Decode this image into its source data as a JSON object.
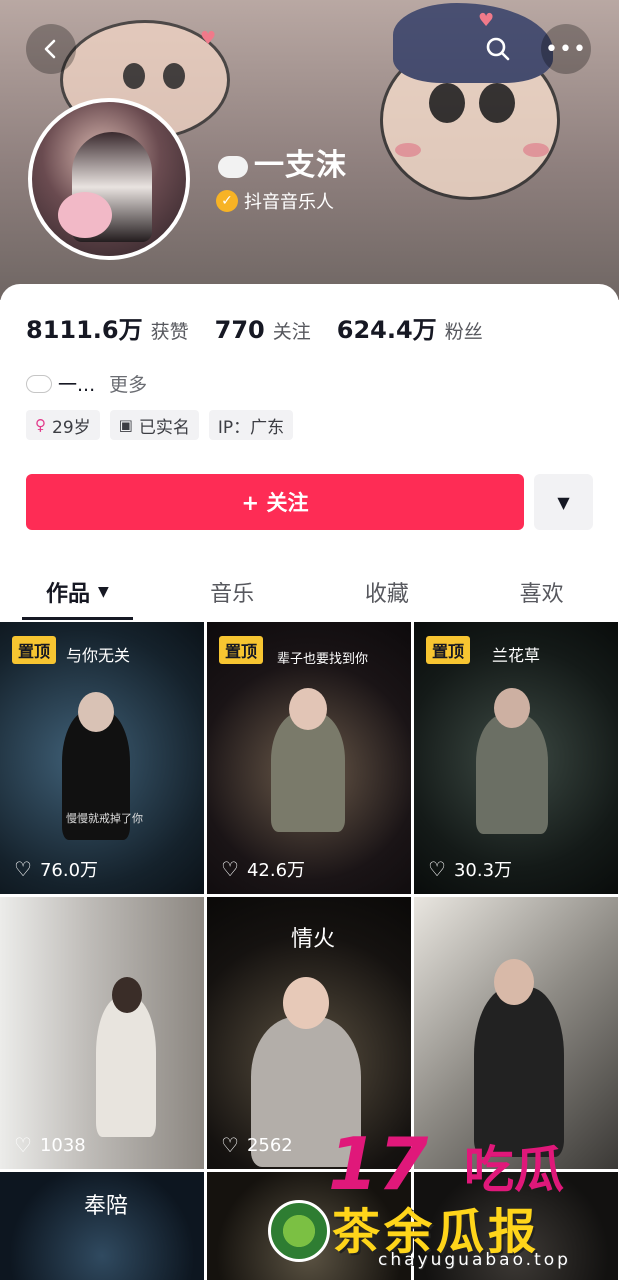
{
  "header": {
    "back_icon": "chevron-left-icon",
    "search_icon": "search-icon",
    "more_icon": "more-dots-icon",
    "more_glyph": "•••",
    "name": "一支沫",
    "verified_label": "抖音音乐人"
  },
  "stats": [
    {
      "value": "8111.6万",
      "label": "获赞"
    },
    {
      "value": "770",
      "label": "关注"
    },
    {
      "value": "624.4万",
      "label": "粉丝"
    }
  ],
  "bio": {
    "text": "一...",
    "more": "更多"
  },
  "tags": [
    {
      "icon": "♀",
      "text": "29岁"
    },
    {
      "icon": "▣",
      "text": "已实名"
    },
    {
      "icon": "",
      "text": "IP：广东"
    }
  ],
  "follow_button": "+ 关注",
  "dropdown_glyph": "▼",
  "tabs": [
    {
      "label": "作品",
      "caret": "▼"
    },
    {
      "label": "音乐"
    },
    {
      "label": "收藏"
    },
    {
      "label": "喜欢"
    }
  ],
  "videos": [
    {
      "pinned": "置顶",
      "title": "与你无关",
      "subtitle": "慢慢就戒掉了你",
      "likes": "76.0万"
    },
    {
      "pinned": "置顶",
      "title": "辈子也要找到你",
      "likes": "42.6万"
    },
    {
      "pinned": "置顶",
      "title": "兰花草",
      "likes": "30.3万"
    },
    {
      "likes": "1038"
    },
    {
      "title": "情火",
      "likes": "2562"
    },
    {},
    {
      "title": "奉陪"
    },
    {},
    {}
  ],
  "watermark": {
    "num": "17",
    "brand1": "吃瓜",
    "brand2": "茶余瓜报",
    "url": "chayuguabao.top"
  },
  "colors": {
    "accent": "#fe2c55",
    "pin": "#f7c531",
    "watermark_pink": "#e0187a",
    "watermark_yellow": "#ffd51a"
  }
}
